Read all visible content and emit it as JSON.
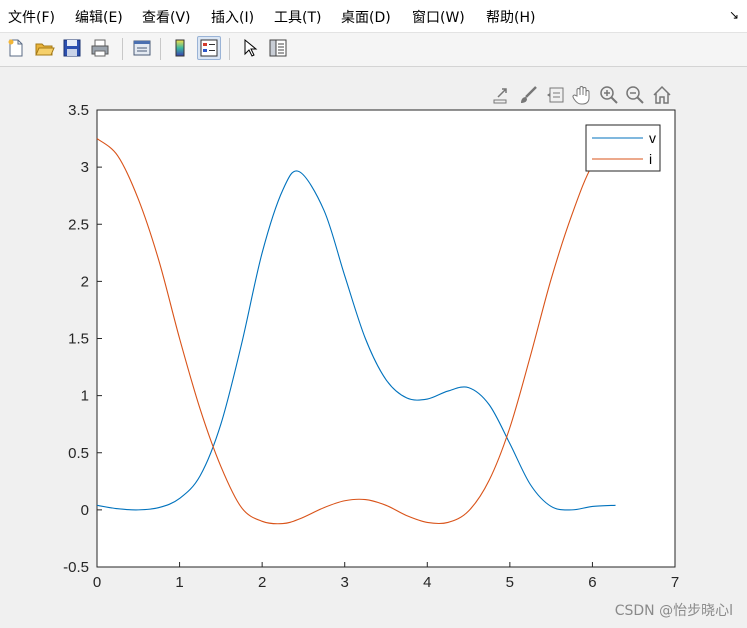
{
  "menu": {
    "items": [
      "文件(F)",
      "编辑(E)",
      "查看(V)",
      "插入(I)",
      "工具(T)",
      "桌面(D)",
      "窗口(W)",
      "帮助(H)"
    ],
    "corner": "↘"
  },
  "toolbar": {
    "buttons": [
      "new-figure",
      "open-file",
      "save",
      "print",
      "link-plot",
      "insert-colorbar",
      "insert-legend",
      "edit-plot",
      "property-inspector"
    ]
  },
  "axes_toolbar": {
    "buttons": [
      "export",
      "brush",
      "data-tips",
      "pan",
      "zoom-in",
      "zoom-out",
      "home"
    ]
  },
  "colors": {
    "v": "#0072BD",
    "i": "#D95319"
  },
  "chart_data": {
    "type": "line",
    "title": "",
    "xlabel": "",
    "ylabel": "",
    "xlim": [
      0,
      7
    ],
    "ylim": [
      -0.5,
      3.5
    ],
    "x_ticks": [
      "0",
      "1",
      "2",
      "3",
      "4",
      "5",
      "6",
      "7"
    ],
    "y_ticks": [
      "-0.5",
      "0",
      "0.5",
      "1",
      "1.5",
      "2",
      "2.5",
      "3",
      "3.5"
    ],
    "grid": false,
    "legend_position": "top-right",
    "x": [
      0,
      0.25,
      0.5,
      0.75,
      1.0,
      1.25,
      1.5,
      1.75,
      2.0,
      2.25,
      2.45,
      2.75,
      3.0,
      3.25,
      3.5,
      3.75,
      4.0,
      4.25,
      4.5,
      4.75,
      5.0,
      5.25,
      5.5,
      5.75,
      6.0,
      6.28
    ],
    "series": [
      {
        "name": "v",
        "values": [
          0.04,
          0.01,
          0.0,
          0.02,
          0.1,
          0.3,
          0.75,
          1.45,
          2.25,
          2.8,
          2.96,
          2.62,
          2.05,
          1.5,
          1.14,
          0.98,
          0.97,
          1.04,
          1.07,
          0.92,
          0.58,
          0.22,
          0.03,
          0.0,
          0.03,
          0.04
        ]
      },
      {
        "name": "i",
        "values": [
          3.25,
          3.1,
          2.72,
          2.18,
          1.5,
          0.88,
          0.38,
          0.02,
          -0.1,
          -0.12,
          -0.08,
          0.02,
          0.08,
          0.09,
          0.04,
          -0.05,
          -0.11,
          -0.11,
          -0.01,
          0.26,
          0.72,
          1.35,
          2.02,
          2.58,
          3.02,
          3.25
        ]
      }
    ]
  },
  "watermark": "CSDN @怡步晓心l"
}
